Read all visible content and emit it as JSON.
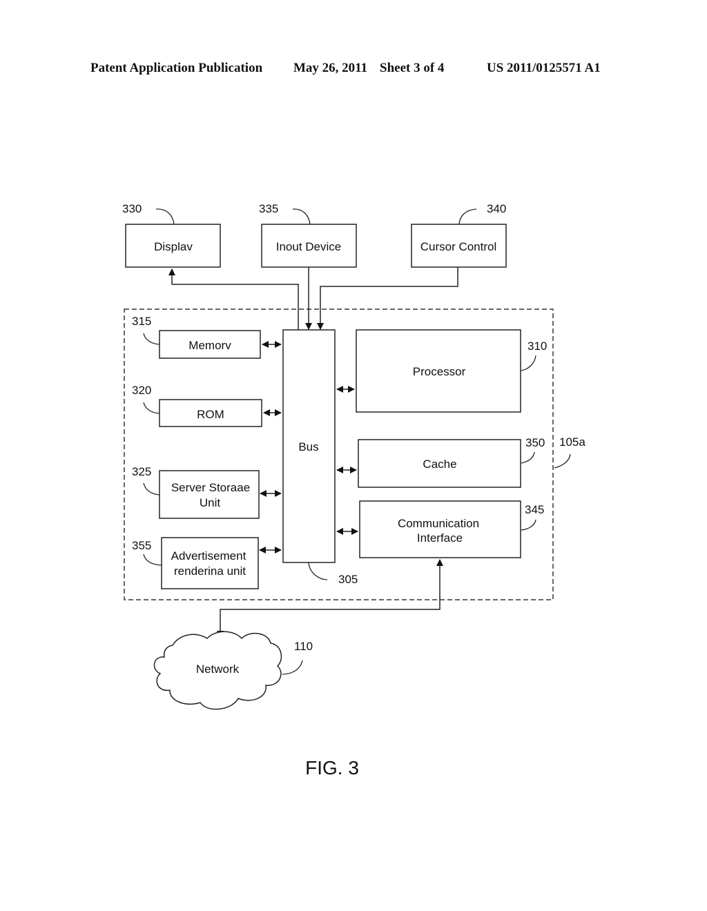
{
  "header": {
    "publication": "Patent Application Publication",
    "date": "May 26, 2011",
    "sheet": "Sheet 3 of 4",
    "number": "US 2011/0125571 A1"
  },
  "figure": {
    "caption": "FIG. 3",
    "system_ref": "105a",
    "blocks": {
      "display": {
        "label": "Displav",
        "ref": "330"
      },
      "input_device": {
        "label": "Inout Device",
        "ref": "335"
      },
      "cursor_control": {
        "label": "Cursor Control",
        "ref": "340"
      },
      "memory": {
        "label": "Memorv",
        "ref": "315"
      },
      "rom": {
        "label": "ROM",
        "ref": "320"
      },
      "server_storage": {
        "label_line1": "Server Storaae",
        "label_line2": "Unit",
        "ref": "325"
      },
      "ad_rendering": {
        "label_line1": "Advertisement",
        "label_line2": "renderina unit",
        "ref": "355"
      },
      "bus": {
        "label": "Bus",
        "ref": "305"
      },
      "processor": {
        "label": "Processor",
        "ref": "310"
      },
      "cache": {
        "label": "Cache",
        "ref": "350"
      },
      "comm_interface": {
        "label_line1": "Communication",
        "label_line2": "Interface",
        "ref": "345"
      },
      "network": {
        "label": "Network",
        "ref": "110"
      }
    }
  }
}
